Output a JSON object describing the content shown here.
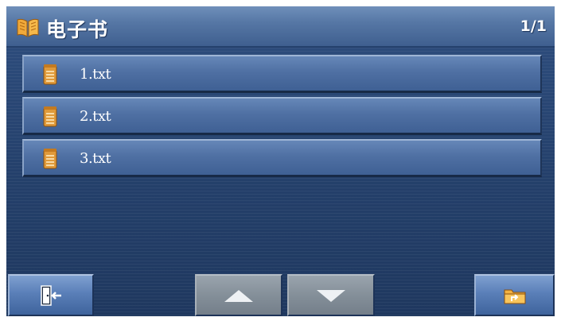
{
  "header": {
    "title": "电子书",
    "page_counter": "1/1",
    "icon": "open-book-icon"
  },
  "files": [
    {
      "name": "1.txt",
      "icon": "text-file-icon"
    },
    {
      "name": "2.txt",
      "icon": "text-file-icon"
    },
    {
      "name": "3.txt",
      "icon": "text-file-icon"
    }
  ],
  "toolbar": {
    "exit_icon": "exit-door-icon",
    "up_icon": "arrow-up-icon",
    "down_icon": "arrow-down-icon",
    "folder_icon": "folder-up-icon"
  },
  "colors": {
    "background": "#24406b",
    "titlebar": "#5677a5",
    "row": "#4f70a3",
    "file_icon": "#e09a3a",
    "nav_button": "#848f99"
  }
}
